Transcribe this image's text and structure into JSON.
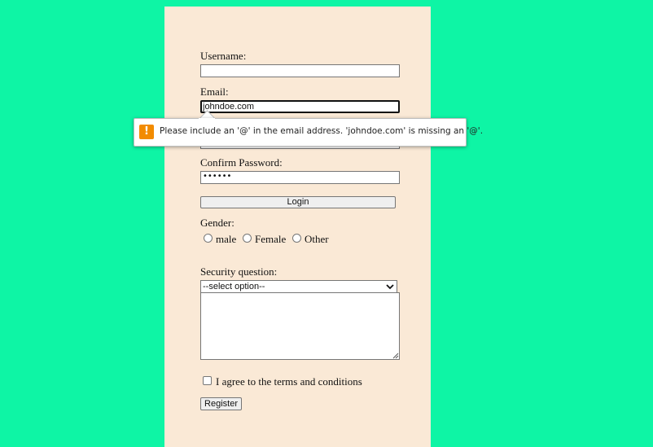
{
  "form": {
    "username_label": "Username:",
    "username_value": "",
    "email_label": "Email:",
    "email_value": "johndoe.com",
    "confirm_password_label": "Confirm Password:",
    "confirm_password_value": "••••••",
    "login_button": "Login",
    "gender_label": "Gender:",
    "gender_options": [
      "male",
      "Female",
      "Other"
    ],
    "security_question_label": "Security question:",
    "security_question_selected": "--select option--",
    "security_answer_value": "",
    "terms_label": "I agree to the terms and conditions",
    "register_button": "Register"
  },
  "validation_tooltip": {
    "icon": "warning-icon",
    "icon_glyph": "!",
    "message": "Please include an '@' in the email address. 'johndoe.com' is missing an '@'."
  },
  "colors": {
    "page_background": "#0ef5a5",
    "form_background": "#fae9d6",
    "warning_icon": "#f28b00"
  }
}
